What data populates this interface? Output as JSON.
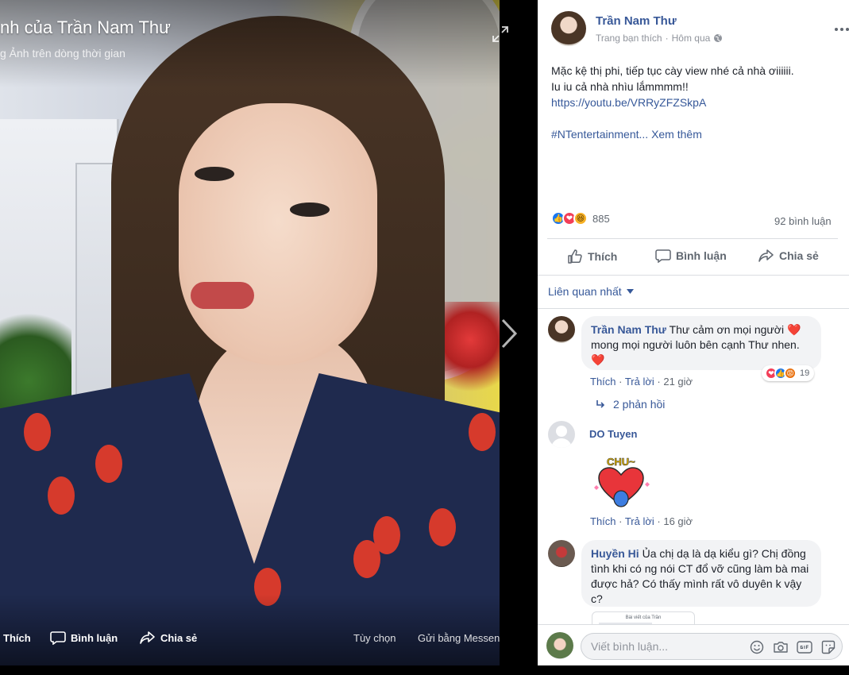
{
  "colors": {
    "link": "#385898",
    "like_blue": "#1877f2",
    "love_red": "#f33e58",
    "secondary_text": "#606770"
  },
  "viewer": {
    "album_title": "nh của Trần Nam Thư",
    "album_subtitle": "g Ảnh trên dòng thời gian",
    "actions": {
      "like": "Thích",
      "comment": "Bình luận",
      "share": "Chia sẻ",
      "options": "Tùy chọn",
      "send_messenger": "Gửi bằng Messenger"
    },
    "icons": [
      "expand-icon",
      "next-arrow-icon"
    ]
  },
  "post": {
    "author": "Trần Nam Thư",
    "page_type": "Trang bạn thích",
    "separator": "·",
    "time": "Hôm qua",
    "privacy_icon": "globe-icon",
    "text_lines": [
      "Mặc kệ thị phi, tiếp tục cày view nhé cả nhà ơiiiiii.",
      "Iu iu cả nhà nhìu lắmmmm!!"
    ],
    "link": "https://youtu.be/VRRyZFZSkpA",
    "hashtag": "#NTentertainment...",
    "see_more": "Xem thêm",
    "reaction_count": "885",
    "comment_count": "92 bình luận",
    "actions": {
      "like": "Thích",
      "comment": "Bình luận",
      "share": "Chia sẻ"
    }
  },
  "comments_sort": "Liên quan nhất",
  "comments": [
    {
      "name": "Trần Nam Thư",
      "text_line1": "Thư cảm ơn mọi người",
      "text_line2": "mong mọi người luôn bên cạnh Thư nhen.",
      "like": "Thích",
      "reply": "Trả lời",
      "time": "21 giờ",
      "reaction_count": "19",
      "replies": "2 phản hồi"
    },
    {
      "name": "DO Tuyen",
      "sticker_text": "CHU~",
      "like": "Thích",
      "reply": "Trả lời",
      "time": "16 giờ"
    },
    {
      "name": "Huyền Hi",
      "text_line1": "Ủa chị dạ là dạ kiểu gì? Chị đồng",
      "text_line2": "tình khi có ng nói CT đổ vỡ cũng làm bà mai",
      "text_line3": "được hả? Có thấy mình rất vô duyên k vậy",
      "text_line4": "c?",
      "attachment_label": "Bài viết của Trần"
    }
  ],
  "composer": {
    "placeholder": "Viết bình luận...",
    "tools": [
      "emoji-icon",
      "camera-icon",
      "gif-icon",
      "sticker-icon"
    ]
  }
}
